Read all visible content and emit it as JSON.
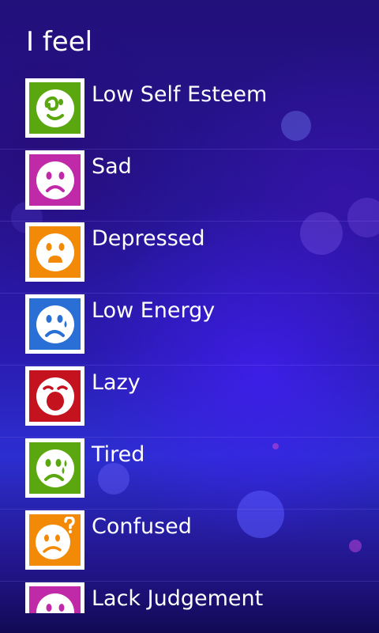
{
  "header": {
    "title": "I feel"
  },
  "feelings": [
    {
      "label": "Low Self Esteem",
      "color": "#5aa70f",
      "icon": "embarrassed-face-icon"
    },
    {
      "label": "Sad",
      "color": "#c02aa8",
      "icon": "sad-face-icon"
    },
    {
      "label": "Depressed",
      "color": "#f28a07",
      "icon": "depressed-face-icon"
    },
    {
      "label": "Low Energy",
      "color": "#2a6fd6",
      "icon": "crying-face-icon"
    },
    {
      "label": "Lazy",
      "color": "#c4121f",
      "icon": "yawning-face-icon"
    },
    {
      "label": "Tired",
      "color": "#5aa70f",
      "icon": "sweating-face-icon"
    },
    {
      "label": "Confused",
      "color": "#f28a07",
      "icon": "confused-face-icon"
    },
    {
      "label": "Lack Judgement",
      "color": "#c02aa8",
      "icon": "face-icon"
    }
  ]
}
